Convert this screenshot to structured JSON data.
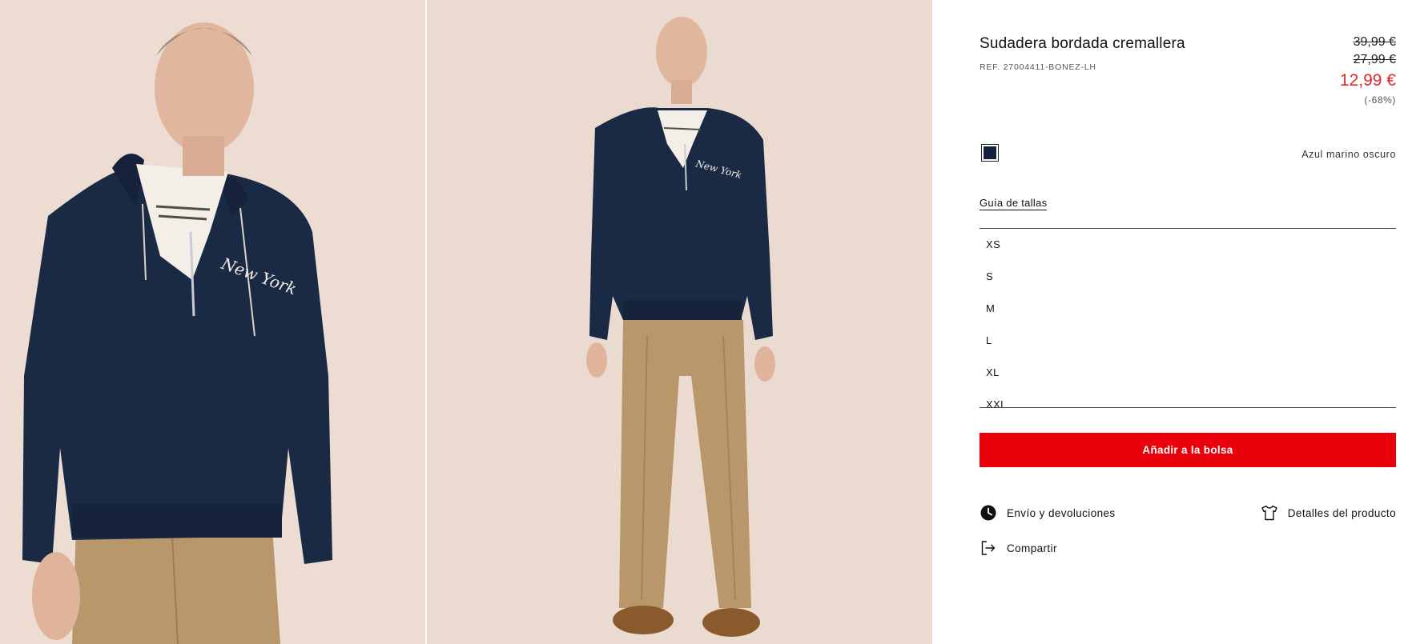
{
  "product": {
    "title": "Sudadera bordada cremallera",
    "ref": "REF. 27004411-BONEZ-LH",
    "prices": {
      "original": "39,99 €",
      "previous": "27,99 €",
      "current": "12,99 €",
      "discount": "(-68%)"
    },
    "color": {
      "name": "Azul marino oscuro",
      "swatch_hex": "#14213a"
    },
    "size_guide_label": "Guía de tallas",
    "sizes": [
      "XS",
      "S",
      "M",
      "L",
      "XL",
      "XXL"
    ],
    "add_to_bag_label": "Añadir a la bolsa",
    "links": {
      "shipping": "Envío y devoluciones",
      "details": "Detalles del producto",
      "share": "Compartir"
    }
  },
  "embroidery_text": "New York",
  "colors": {
    "accent_red": "#e8000b",
    "price_red": "#e4262a",
    "hoodie_navy": "#1b2a44",
    "trousers_khaki": "#b8976a",
    "background": "#ecdcd2"
  }
}
